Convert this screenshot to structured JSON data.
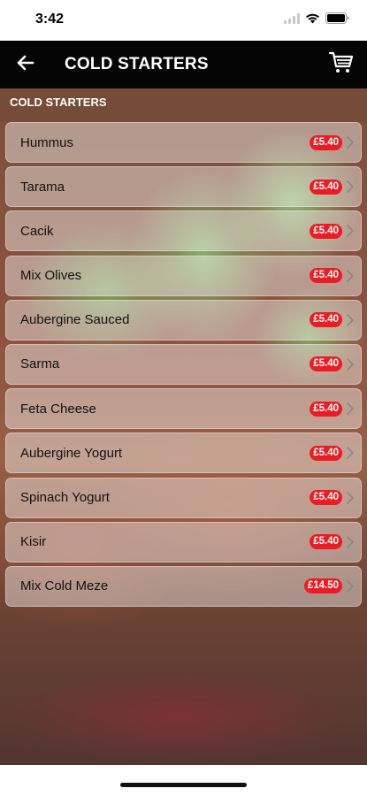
{
  "status_bar": {
    "time": "3:42",
    "icons": [
      "signal-icon",
      "wifi-icon",
      "battery-icon"
    ]
  },
  "nav": {
    "back_icon": "back-arrow-icon",
    "title": "COLD STARTERS",
    "cart_icon": "cart-icon"
  },
  "section": {
    "title": "COLD STARTERS"
  },
  "menu_items": [
    {
      "name": "Hummus",
      "price": "£5.40"
    },
    {
      "name": "Tarama",
      "price": "£5.40"
    },
    {
      "name": "Cacik",
      "price": "£5.40"
    },
    {
      "name": "Mix Olives",
      "price": "£5.40"
    },
    {
      "name": "Aubergine Sauced",
      "price": "£5.40"
    },
    {
      "name": "Sarma",
      "price": "£5.40"
    },
    {
      "name": "Feta Cheese",
      "price": "£5.40"
    },
    {
      "name": "Aubergine Yogurt",
      "price": "£5.40"
    },
    {
      "name": "Spinach Yogurt",
      "price": "£5.40"
    },
    {
      "name": "Kisir",
      "price": "£5.40"
    },
    {
      "name": "Mix Cold Meze",
      "price": "£14.50"
    }
  ],
  "colors": {
    "nav_background": "#050505",
    "price_badge": "#ec1c24"
  }
}
